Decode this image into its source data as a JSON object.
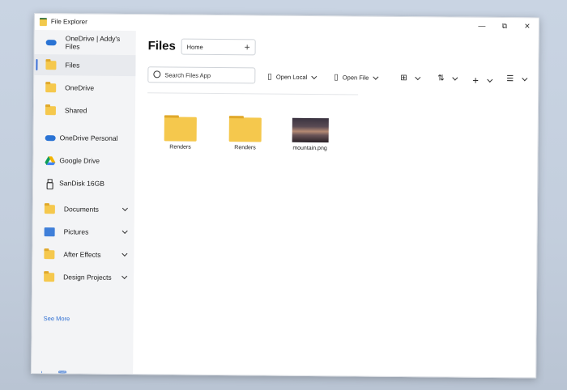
{
  "window": {
    "title": "File Explorer",
    "controls": {
      "minimize": "—",
      "maximize": "⧉",
      "close": "✕"
    }
  },
  "sidebar": {
    "header": "OneDrive | Addy's Files",
    "items": [
      {
        "label": "Files",
        "icon": "folder-icon"
      },
      {
        "label": "OneDrive",
        "icon": "folder-icon"
      },
      {
        "label": "Shared",
        "icon": "shared-folder-icon"
      },
      {
        "label": "OneDrive Personal",
        "icon": "cloud-icon"
      },
      {
        "label": "Google Drive",
        "icon": "google-drive-icon"
      },
      {
        "label": "SanDisk 16GB",
        "icon": "usb-drive-icon"
      },
      {
        "label": "Documents",
        "icon": "folder-icon"
      },
      {
        "label": "Pictures",
        "icon": "pictures-icon"
      },
      {
        "label": "After Effects",
        "icon": "folder-icon"
      },
      {
        "label": "Design Projects",
        "icon": "folder-icon"
      }
    ],
    "see_more": "See More",
    "bottom": {
      "download_icon": "⤓",
      "trash_icon": "🗑"
    }
  },
  "main": {
    "title": "Files",
    "tab": {
      "label": "Home",
      "add": "+"
    },
    "search": {
      "placeholder": "Search Files App"
    },
    "toolbar": {
      "open_local": "Open Local",
      "open_file": "Open File",
      "view_icon": "⊞",
      "sort_icon": "⇅",
      "new_icon": "+",
      "select_icon": "☰"
    },
    "files": [
      {
        "name": "Renders",
        "type": "folder"
      },
      {
        "name": "Renders",
        "type": "folder"
      },
      {
        "name": "mountain.png",
        "type": "image"
      }
    ]
  },
  "colors": {
    "accent": "#3b6fd6",
    "folder": "#f5c84d",
    "sidebar_bg": "#f3f4f6"
  }
}
